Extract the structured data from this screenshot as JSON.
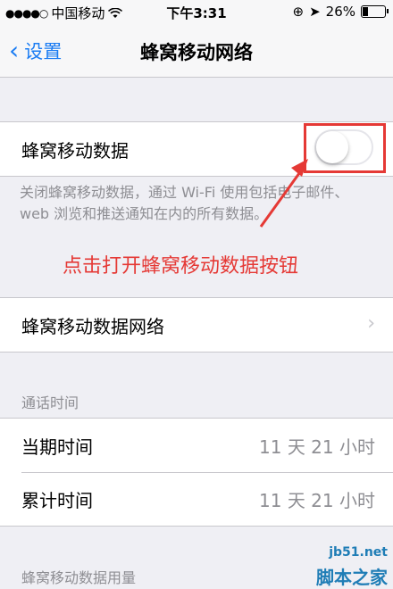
{
  "status_bar": {
    "carrier": "中国移动",
    "time": "下午3:31",
    "battery": "26%",
    "battery_level": 0.26
  },
  "nav": {
    "back_label": "设置",
    "title": "蜂窝移动网络"
  },
  "cellular_data": {
    "label": "蜂窝移动数据",
    "enabled": false
  },
  "description": "关闭蜂窝移动数据，通过 Wi-Fi 使用包括电子邮件、web 浏览和推送通知在内的所有数据。",
  "annotation": "点击打开蜂窝移动数据按钮",
  "cellular_network": {
    "label": "蜂窝移动数据网络"
  },
  "call_time": {
    "header": "通话时间",
    "rows": [
      {
        "label": "当期时间",
        "value": "11 天 21 小时"
      },
      {
        "label": "累计时间",
        "value": "11 天 21 小时"
      }
    ]
  },
  "usage_header": "蜂窝移动数据用量",
  "watermark": {
    "url": "jb51.net",
    "text": "脚本之家"
  },
  "colors": {
    "accent": "#1a7cf3",
    "annotation": "#e53935"
  }
}
